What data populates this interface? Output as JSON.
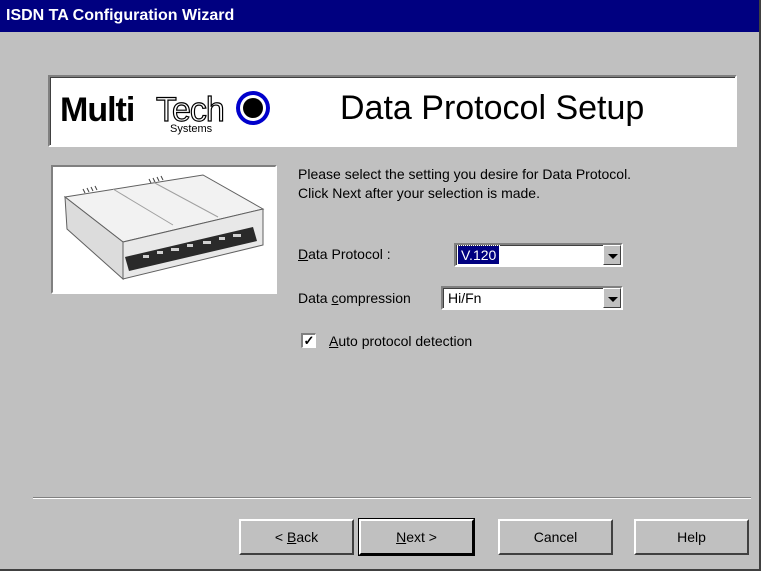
{
  "window": {
    "title": "ISDN TA Configuration Wizard"
  },
  "banner": {
    "logo_multi": "Multi",
    "logo_tech": "Tech",
    "logo_systems": "Systems",
    "title": "Data Protocol Setup"
  },
  "instructions": {
    "line1": "Please select the setting you desire for Data Protocol.",
    "line2": "Click Next after your selection is made."
  },
  "form": {
    "protocol_label_accel": "D",
    "protocol_label_rest": "ata Protocol :",
    "protocol_value": "V.120",
    "compression_label_pre": "Data ",
    "compression_label_accel": "c",
    "compression_label_rest": "ompression",
    "compression_value": "Hi/Fn",
    "auto_check_mark": "✓",
    "auto_label_accel": "A",
    "auto_label_rest": "uto protocol detection"
  },
  "buttons": {
    "back_pre": "< ",
    "back_accel": "B",
    "back_rest": "ack",
    "next_accel": "N",
    "next_rest": "ext >",
    "cancel": "Cancel",
    "help": "Help"
  },
  "colors": {
    "titlebar": "#000080",
    "face": "#c0c0c0",
    "selection": "#000080"
  },
  "icons": [
    "combo-dropdown-arrow-icon",
    "checkbox-check-icon",
    "multitech-logo-icon",
    "isdn-device-photo-icon"
  ]
}
